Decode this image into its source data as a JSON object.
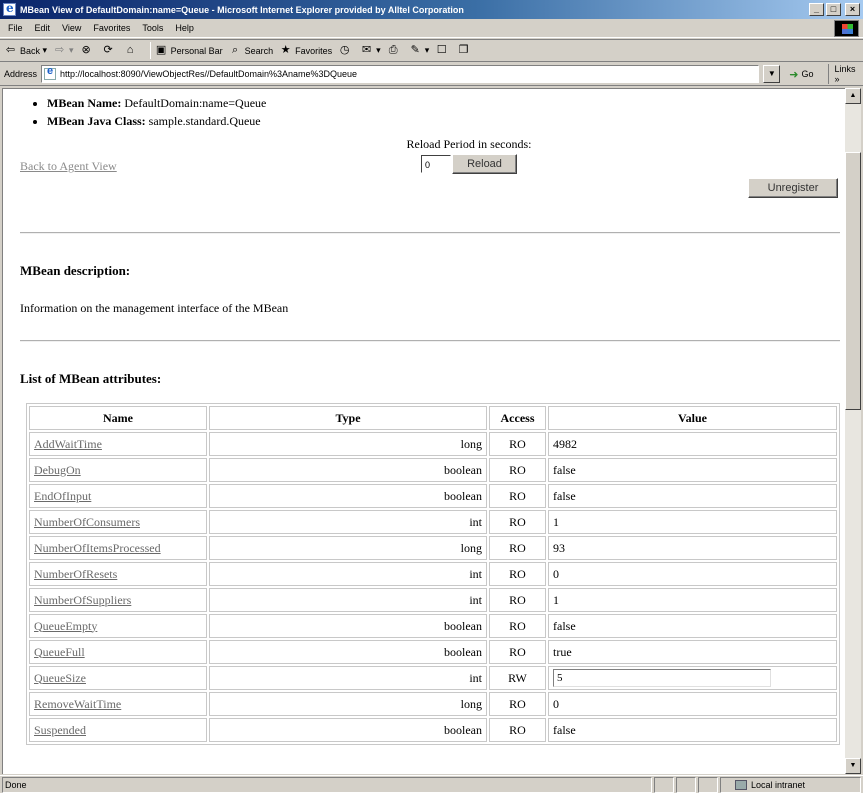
{
  "window": {
    "title": "MBean View of DefaultDomain:name=Queue - Microsoft Internet Explorer provided by Alltel Corporation",
    "minimize": "_",
    "maximize": "□",
    "close": "×"
  },
  "menu": [
    "File",
    "Edit",
    "View",
    "Favorites",
    "Tools",
    "Help"
  ],
  "toolbar": {
    "back": "Back",
    "search": "Search",
    "favorites": "Favorites",
    "personal_bar": "Personal Bar"
  },
  "address": {
    "label": "Address",
    "url": "http://localhost:8090/ViewObjectRes//DefaultDomain%3Aname%3DQueue",
    "go": "Go",
    "links": "Links »"
  },
  "page": {
    "mbean_name_label": "MBean Name:",
    "mbean_name_value": "DefaultDomain:name=Queue",
    "mbean_class_label": "MBean Java Class:",
    "mbean_class_value": "sample.standard.Queue",
    "back_link": "Back to Agent View",
    "reload_label": "Reload Period in seconds:",
    "reload_value": "0",
    "reload_button": "Reload",
    "unregister_button": "Unregister",
    "description_heading": "MBean description:",
    "description_text": "Information on the management interface of the MBean",
    "attributes_heading": "List of MBean attributes:"
  },
  "table": {
    "headers": [
      "Name",
      "Type",
      "Access",
      "Value"
    ],
    "rows": [
      {
        "name": "AddWaitTime",
        "type": "long",
        "access": "RO",
        "value": "4982"
      },
      {
        "name": "DebugOn",
        "type": "boolean",
        "access": "RO",
        "value": "false"
      },
      {
        "name": "EndOfInput",
        "type": "boolean",
        "access": "RO",
        "value": "false"
      },
      {
        "name": "NumberOfConsumers",
        "type": "int",
        "access": "RO",
        "value": "1"
      },
      {
        "name": "NumberOfItemsProcessed",
        "type": "long",
        "access": "RO",
        "value": "93"
      },
      {
        "name": "NumberOfResets",
        "type": "int",
        "access": "RO",
        "value": "0"
      },
      {
        "name": "NumberOfSuppliers",
        "type": "int",
        "access": "RO",
        "value": "1"
      },
      {
        "name": "QueueEmpty",
        "type": "boolean",
        "access": "RO",
        "value": "false"
      },
      {
        "name": "QueueFull",
        "type": "boolean",
        "access": "RO",
        "value": "true"
      },
      {
        "name": "QueueSize",
        "type": "int",
        "access": "RW",
        "value": "5",
        "editable": true
      },
      {
        "name": "RemoveWaitTime",
        "type": "long",
        "access": "RO",
        "value": "0"
      },
      {
        "name": "Suspended",
        "type": "boolean",
        "access": "RO",
        "value": "false"
      }
    ]
  },
  "status": {
    "text": "Done",
    "zone": "Local intranet"
  }
}
